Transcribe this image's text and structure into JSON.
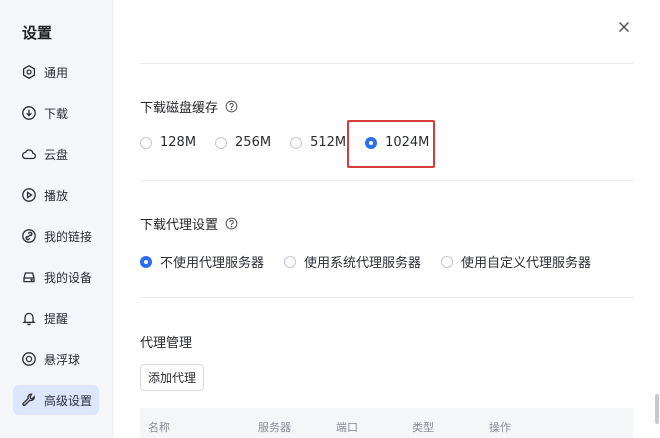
{
  "sidebar": {
    "title": "设置",
    "items": [
      {
        "label": "通用",
        "icon": "general-icon"
      },
      {
        "label": "下载",
        "icon": "download-icon"
      },
      {
        "label": "云盘",
        "icon": "cloud-icon"
      },
      {
        "label": "播放",
        "icon": "play-icon"
      },
      {
        "label": "我的链接",
        "icon": "link-icon"
      },
      {
        "label": "我的设备",
        "icon": "device-icon"
      },
      {
        "label": "提醒",
        "icon": "bell-icon"
      },
      {
        "label": "悬浮球",
        "icon": "float-ball-icon"
      },
      {
        "label": "高级设置",
        "icon": "wrench-icon",
        "active": true
      }
    ]
  },
  "cache": {
    "title": "下载磁盘缓存",
    "options": [
      "128M",
      "256M",
      "512M",
      "1024M"
    ],
    "selected": "1024M"
  },
  "proxy": {
    "title": "下载代理设置",
    "options": [
      "不使用代理服务器",
      "使用系统代理服务器",
      "使用自定义代理服务器"
    ],
    "selected": "不使用代理服务器"
  },
  "proxy_manage": {
    "title": "代理管理",
    "add_label": "添加代理",
    "columns": [
      "名称",
      "服务器",
      "端口",
      "类型",
      "操作"
    ]
  },
  "colors": {
    "accent": "#2f6ef0",
    "highlight": "#d93a3a",
    "sidebar_bg": "#f5f6fa",
    "active_bg": "#dde7fb"
  }
}
